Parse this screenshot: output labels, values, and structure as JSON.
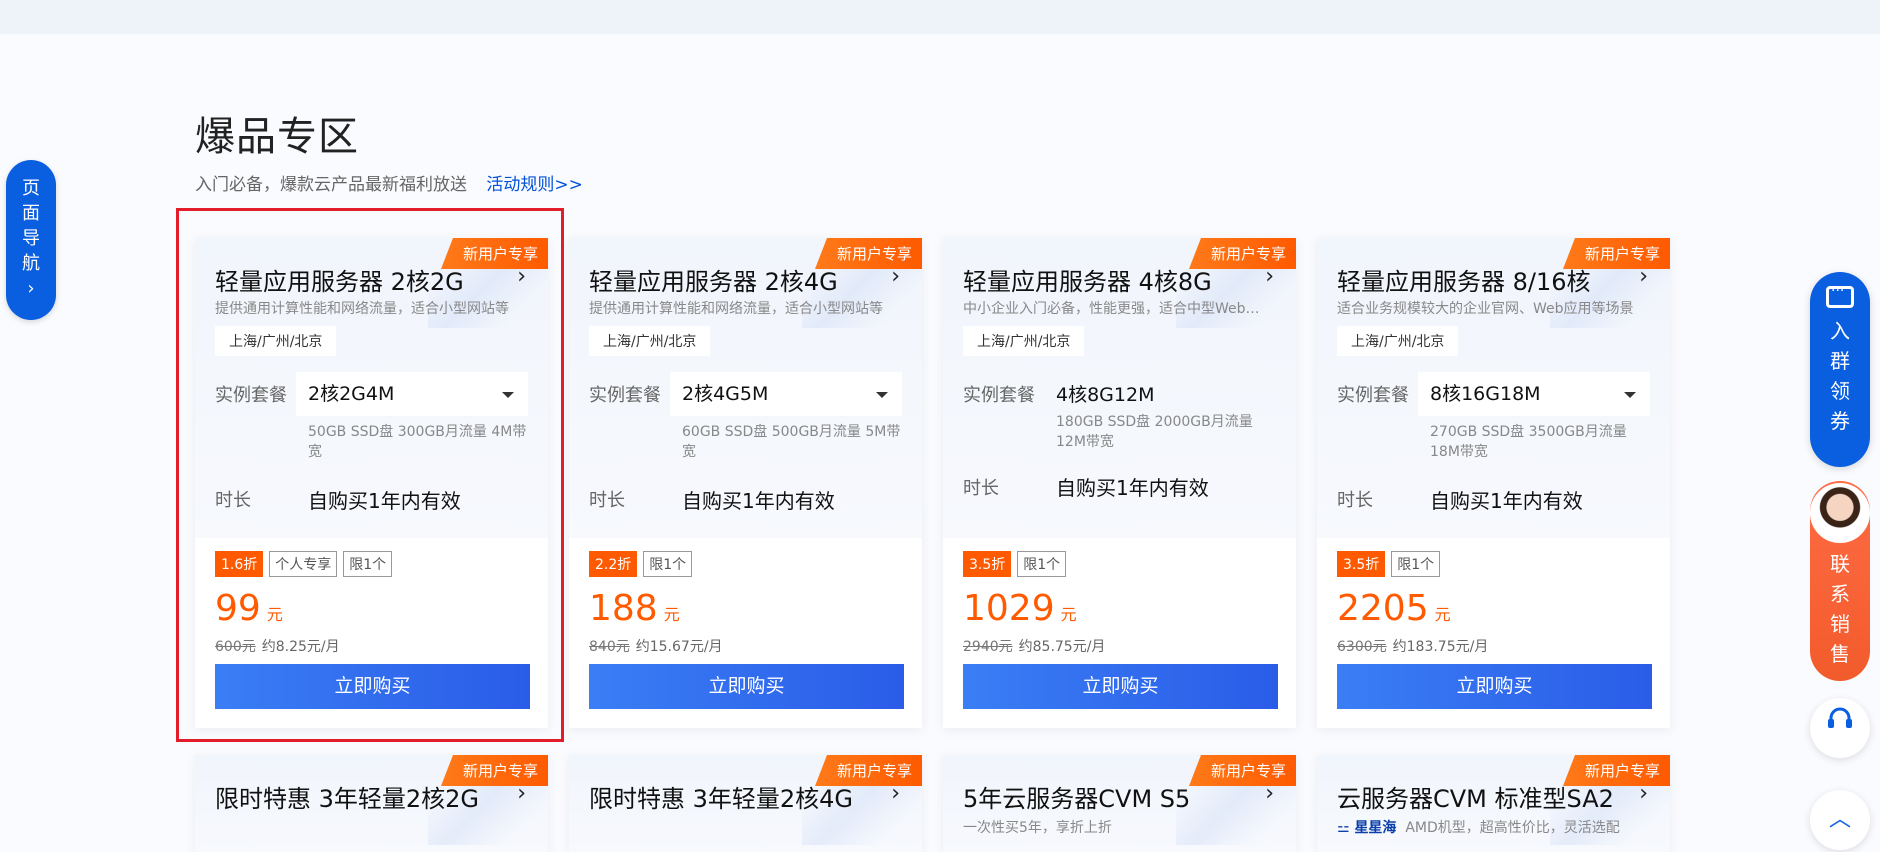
{
  "section": {
    "title": "爆品专区",
    "subtitle": "入门必备，爆款云产品最新福利放送",
    "rules_link": "活动规则>>"
  },
  "side_nav": {
    "label_chars": [
      "页",
      "面",
      "导",
      "航"
    ],
    "arrow": "›"
  },
  "right_rail": {
    "group_chars": [
      "入",
      "群",
      "领",
      "券"
    ],
    "sales_chars": [
      "联",
      "系",
      "销",
      "售"
    ],
    "top_arrow": "︿"
  },
  "cards": [
    {
      "ribbon": "新用户专享",
      "title": "轻量应用服务器 2核2G",
      "arrow": "›",
      "desc": "提供通用计算性能和网络流量，适合小型网站等",
      "region": "上海/广州/北京",
      "plan_label": "实例套餐",
      "plan_value": "2核2G4M",
      "plan_spec": "50GB SSD盘 300GB月流量 4M带宽",
      "duration_label": "时长",
      "duration_value": "自购买1年内有效",
      "discount": "1.6折",
      "tags": [
        "个人专享",
        "限1个"
      ],
      "price": "99",
      "price_unit": "元",
      "original_price": "600元",
      "monthly": "约8.25元/月",
      "buy_label": "立即购买"
    },
    {
      "ribbon": "新用户专享",
      "title": "轻量应用服务器 2核4G",
      "arrow": "›",
      "desc": "提供通用计算性能和网络流量，适合小型网站等",
      "region": "上海/广州/北京",
      "plan_label": "实例套餐",
      "plan_value": "2核4G5M",
      "plan_spec": "60GB SSD盘 500GB月流量 5M带宽",
      "duration_label": "时长",
      "duration_value": "自购买1年内有效",
      "discount": "2.2折",
      "tags": [
        "限1个"
      ],
      "price": "188",
      "price_unit": "元",
      "original_price": "840元",
      "monthly": "约15.67元/月",
      "buy_label": "立即购买"
    },
    {
      "ribbon": "新用户专享",
      "title": "轻量应用服务器 4核8G",
      "arrow": "›",
      "desc": "中小企业入门必备，性能更强，适合中型Web应用",
      "region": "上海/广州/北京",
      "plan_label": "实例套餐",
      "plan_value": "4核8G12M",
      "plan_spec": "180GB SSD盘 2000GB月流量 12M带宽",
      "duration_label": "时长",
      "duration_value": "自购买1年内有效",
      "discount": "3.5折",
      "tags": [
        "限1个"
      ],
      "price": "1029",
      "price_unit": "元",
      "original_price": "2940元",
      "monthly": "约85.75元/月",
      "buy_label": "立即购买"
    },
    {
      "ribbon": "新用户专享",
      "title": "轻量应用服务器 8/16核",
      "arrow": "›",
      "desc": "适合业务规模较大的企业官网、Web应用等场景",
      "region": "上海/广州/北京",
      "plan_label": "实例套餐",
      "plan_value": "8核16G18M",
      "plan_spec": "270GB SSD盘 3500GB月流量 18M带宽",
      "duration_label": "时长",
      "duration_value": "自购买1年内有效",
      "discount": "3.5折",
      "tags": [
        "限1个"
      ],
      "price": "2205",
      "price_unit": "元",
      "original_price": "6300元",
      "monthly": "约183.75元/月",
      "buy_label": "立即购买"
    }
  ],
  "cards_row2": [
    {
      "ribbon": "新用户专享",
      "title": "限时特惠 3年轻量2核2G",
      "arrow": "›",
      "desc": ""
    },
    {
      "ribbon": "新用户专享",
      "title": "限时特惠 3年轻量2核4G",
      "arrow": "›",
      "desc": ""
    },
    {
      "ribbon": "新用户专享",
      "title": "5年云服务器CVM S5",
      "arrow": "›",
      "desc": "一次性买5年，享折上折"
    },
    {
      "ribbon": "新用户专享",
      "title": "云服务器CVM 标准型SA2",
      "arrow": "›",
      "brand": "星星海",
      "desc": "AMD机型，超高性价比，灵活选配"
    }
  ]
}
